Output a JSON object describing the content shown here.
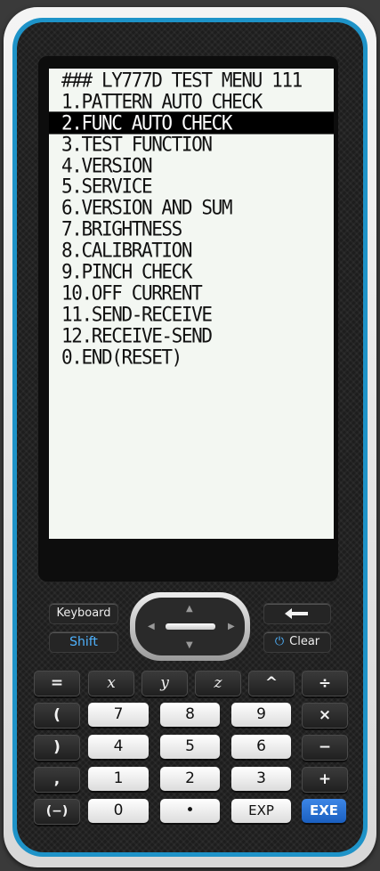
{
  "screen": {
    "lines": [
      "### LY777D TEST MENU 111",
      "1.PATTERN AUTO CHECK",
      "2.FUNC AUTO CHECK",
      "3.TEST FUNCTION",
      "4.VERSION",
      "5.SERVICE",
      "6.VERSION AND SUM",
      "7.BRIGHTNESS",
      "8.CALIBRATION",
      "9.PINCH CHECK",
      "10.OFF CURRENT",
      "11.SEND-RECEIVE",
      "12.RECEIVE-SEND",
      "0.END(RESET)"
    ],
    "selected_index": 2
  },
  "function_keys": {
    "keyboard": "Keyboard",
    "shift": "Shift",
    "backspace_icon": "left-arrow",
    "clear": "Clear",
    "power_icon": "power"
  },
  "navpad": {
    "up": "▲",
    "down": "▼",
    "left": "◀",
    "right": "▶"
  },
  "keys": {
    "row1": [
      "=",
      "x",
      "y",
      "z",
      "^",
      "÷"
    ],
    "row2": [
      "(",
      "7",
      "8",
      "9",
      "×"
    ],
    "row3": [
      ")",
      "4",
      "5",
      "6",
      "−"
    ],
    "row4": [
      ",",
      "1",
      "2",
      "3",
      "+"
    ],
    "row5": [
      "(−)",
      "0",
      "•",
      "EXP",
      "EXE"
    ]
  },
  "colors": {
    "case_accent": "#1e93c8",
    "shift_text": "#4fb3ff",
    "exe_key": "#2e74d6",
    "lcd_background": "#f3f7f2"
  }
}
